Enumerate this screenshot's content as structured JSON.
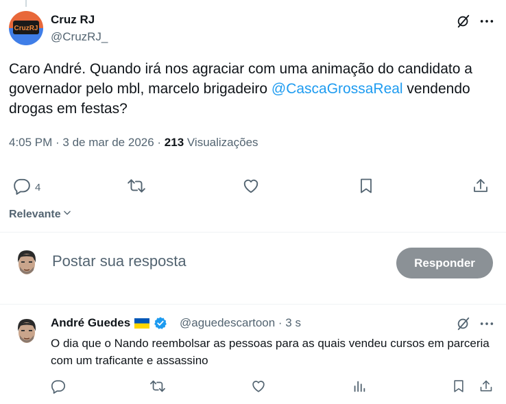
{
  "tweet": {
    "author": {
      "name": "Cruz RJ",
      "handle": "@CruzRJ_",
      "avatar_text": "CruzRJ"
    },
    "text_parts": {
      "before": "Caro André. Quando irá nos agraciar com uma animação do candidato a governador pelo mbl, marcelo brigadeiro ",
      "mention": "@CascaGrossaReal",
      "after": " vendendo drogas em festas?"
    },
    "meta": {
      "time": "4:05 PM",
      "separator": " · ",
      "date": "3 de mar de 2026",
      "views_count": "213",
      "views_label": " Visualizações"
    },
    "actions": {
      "reply_count": "4"
    }
  },
  "sort": {
    "label": "Relevante"
  },
  "compose": {
    "placeholder": "Postar sua resposta",
    "button_label": "Responder"
  },
  "reply": {
    "author": {
      "name": "André Guedes",
      "flag": "🇺🇦",
      "handle": "@aguedescartoon",
      "time": " · 3 s"
    },
    "text": "O dia que o Nando reembolsar as pessoas para as quais vendeu cursos em parceria com um traficante e assassino"
  },
  "colors": {
    "accent": "#1d9bf0",
    "muted": "#536471",
    "text": "#0f1419",
    "button_disabled": "#8b9196",
    "verified": "#1d9bf0"
  },
  "icons": {
    "grok": "grok-icon",
    "more": "more-icon",
    "reply": "reply-icon",
    "retweet": "retweet-icon",
    "like": "like-icon",
    "bookmark": "bookmark-icon",
    "share": "share-icon",
    "views": "views-icon",
    "verified": "verified-badge-icon",
    "chevron": "chevron-down-icon"
  }
}
